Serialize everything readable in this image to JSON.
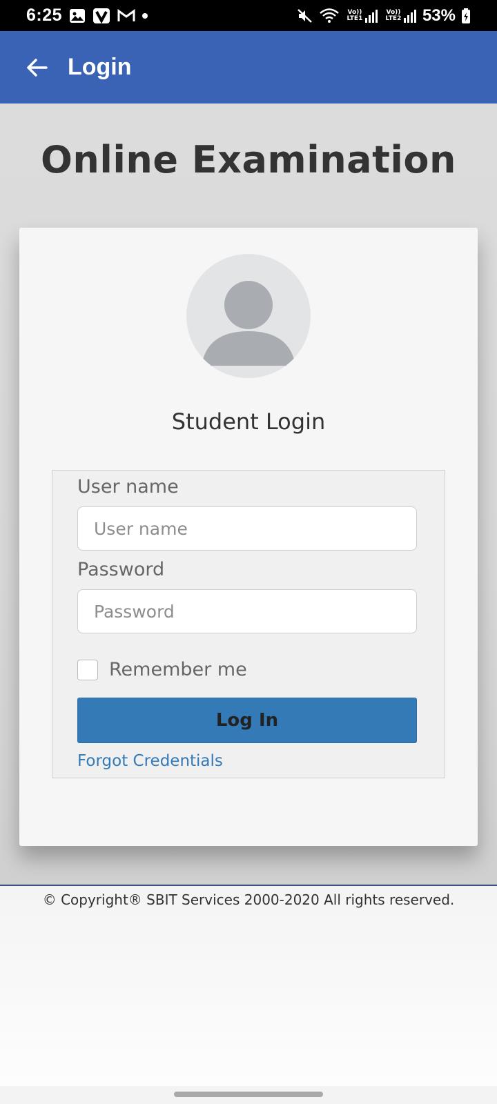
{
  "status_bar": {
    "time": "6:25",
    "battery": "53%",
    "sim1": "Vo)) LTE1",
    "sim2": "Vo)) LTE2",
    "icons": [
      "gallery-icon",
      "v-app-icon",
      "gmail-icon",
      "notification-dot",
      "mute-icon",
      "wifi-icon",
      "signal-icon",
      "battery-icon"
    ]
  },
  "app_bar": {
    "title": "Login",
    "color": "#3a63b5"
  },
  "main": {
    "page_title": "Online Examination",
    "card_heading": "Student Login",
    "form": {
      "username_label": "User name",
      "username_placeholder": "User name",
      "username_value": "",
      "password_label": "Password",
      "password_placeholder": "Password",
      "password_value": "",
      "remember_label": "Remember me",
      "remember_checked": false,
      "login_button": "Log In",
      "forgot_link": "Forgot Credentials"
    },
    "accent_color": "#337ab7"
  },
  "footer": {
    "copyright": "© Copyright® SBIT Services 2000-2020 All rights reserved."
  }
}
